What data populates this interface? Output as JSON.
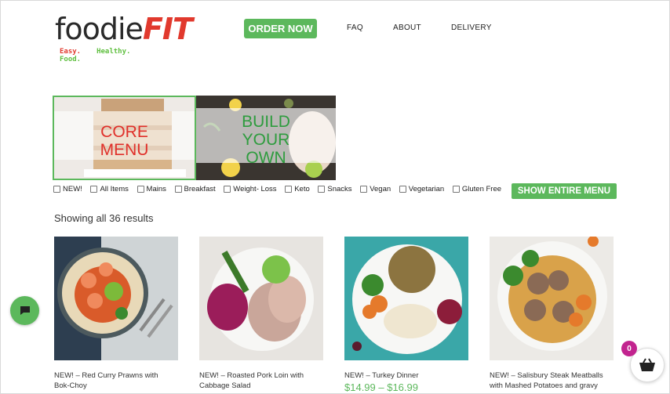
{
  "header": {
    "logo": {
      "main_dark": "foodie",
      "main_accent": "FIT",
      "tag_1": "Easy.",
      "tag_2": "Healthy.",
      "tag_3": "Food."
    },
    "order_button": "ORDER NOW",
    "nav": {
      "faq": "FAQ",
      "about": "ABOUT",
      "delivery": "DELIVERY"
    }
  },
  "categories": {
    "core": {
      "line1": "CORE",
      "line2": "MENU"
    },
    "build": {
      "line1": "BUILD",
      "line2": "YOUR",
      "line3": "OWN"
    }
  },
  "filters": [
    "NEW!",
    "All Items",
    "Mains",
    "Breakfast",
    "Weight- Loss",
    "Keto",
    "Snacks",
    "Vegan",
    "Vegetarian",
    "Gluten Free"
  ],
  "show_all_button": "SHOW ENTIRE MENU",
  "results_text": "Showing all 36 results",
  "products": [
    {
      "name_line1": "NEW! – Red Curry Prawns with",
      "name_line2": "Bok-Choy",
      "price": ""
    },
    {
      "name_line1": "NEW! – Roasted Pork Loin with",
      "name_line2": "Cabbage Salad",
      "price": ""
    },
    {
      "name_line1": "NEW! – Turkey Dinner",
      "name_line2": "",
      "price": "$14.99 – $16.99"
    },
    {
      "name_line1": "NEW! – Salisbury Steak Meatballs",
      "name_line2": "with Mashed Potatoes and gravy",
      "price": ""
    }
  ],
  "cart": {
    "count": "0",
    "icon": "basket-icon"
  },
  "chat": {
    "icon": "chat-bubble-icon"
  },
  "colors": {
    "brand_green": "#5cb85c",
    "brand_red": "#e1392d",
    "badge": "#c2248f"
  }
}
